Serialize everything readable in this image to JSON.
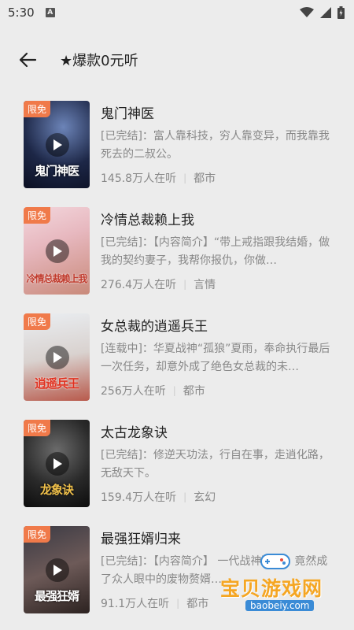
{
  "status": {
    "time": "5:30",
    "notif_icon": "A"
  },
  "header": {
    "title": "★爆款0元听"
  },
  "colors": {
    "badge": "#f07a4a",
    "background": "#ececec"
  },
  "books": [
    {
      "title": "鬼门神医",
      "desc": "[已完结]：富人靠科技，穷人靠变异，而我靠我死去的二叔公。",
      "listeners": "145.8万人在听",
      "category": "都市",
      "badge": "限免",
      "cover_text": "鬼门神医"
    },
    {
      "title": "冷情总裁赖上我",
      "desc": "[已完结]：【内容简介】“带上戒指跟我结婚，做我的契约妻子，我帮你报仇，你做…",
      "listeners": "276.4万人在听",
      "category": "言情",
      "badge": "限免",
      "cover_text": "冷情总裁赖上我"
    },
    {
      "title": "女总裁的逍遥兵王",
      "desc": "[连载中]：华夏战神“孤狼”夏雨，奉命执行最后一次任务，却意外成了绝色女总裁的未…",
      "listeners": "256万人在听",
      "category": "都市",
      "badge": "限免",
      "cover_text": "逍遥兵王"
    },
    {
      "title": "太古龙象诀",
      "desc": "[已完结]：修逆天功法，行自在事，走逍化路，无敌天下。",
      "listeners": "159.4万人在听",
      "category": "玄幻",
      "badge": "限免",
      "cover_text": "龙象诀"
    },
    {
      "title": "最强狂婿归来",
      "desc": "[已完结]：【内容简介】 一代战神醒来，竟然成了众人眼中的废物赘婿…",
      "listeners": "91.1万人在听",
      "category": "都市",
      "badge": "限免",
      "cover_text": "最强狂婿"
    }
  ],
  "watermark": {
    "text": "宝贝游戏网",
    "url": "baobeiy.com"
  }
}
